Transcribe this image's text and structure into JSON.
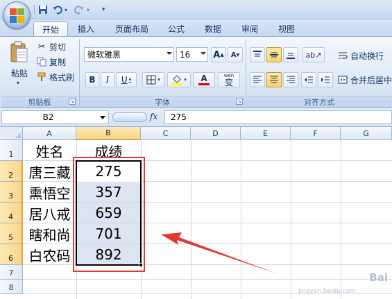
{
  "quick_access": {
    "save": "save",
    "undo": "undo",
    "redo": "redo"
  },
  "tabs": [
    "开始",
    "插入",
    "页面布局",
    "公式",
    "数据",
    "审阅",
    "视图"
  ],
  "active_tab": "开始",
  "clipboard": {
    "paste": "粘贴",
    "cut": "剪切",
    "copy": "复制",
    "format_painter": "格式刷",
    "group_label": "剪贴板"
  },
  "font": {
    "name": "微软雅黑",
    "size": "16",
    "grow": "A",
    "shrink": "A",
    "bold": "B",
    "italic": "I",
    "underline": "U",
    "wen": "wén",
    "wen_char": "变",
    "color_a": "A",
    "group_label": "字体"
  },
  "alignment": {
    "wrap_text": "自动换行",
    "merge_center": "合并后居中",
    "group_label": "对齐方式"
  },
  "name_box": "B2",
  "fx": "fx",
  "formula_value": "275",
  "columns": [
    "A",
    "B",
    "C",
    "D",
    "E",
    "F",
    "G"
  ],
  "rows": [
    "1",
    "2",
    "3",
    "4",
    "5",
    "6",
    "7",
    "8"
  ],
  "cells": {
    "header": [
      "姓名",
      "成绩"
    ],
    "names": [
      "唐三藏",
      "熏悟空",
      "居八戒",
      "瞎和尚",
      "白农码"
    ],
    "scores": [
      "275",
      "357",
      "659",
      "701",
      "892"
    ]
  },
  "selected_column": "B",
  "selected_rows": [
    "2",
    "3",
    "4",
    "5",
    "6"
  ],
  "colors": {
    "annotation_red": "#e53935",
    "selection_fill": "#dde4f1"
  },
  "watermark": {
    "main": "Bai",
    "sub": "jingyan.baidu.com"
  }
}
